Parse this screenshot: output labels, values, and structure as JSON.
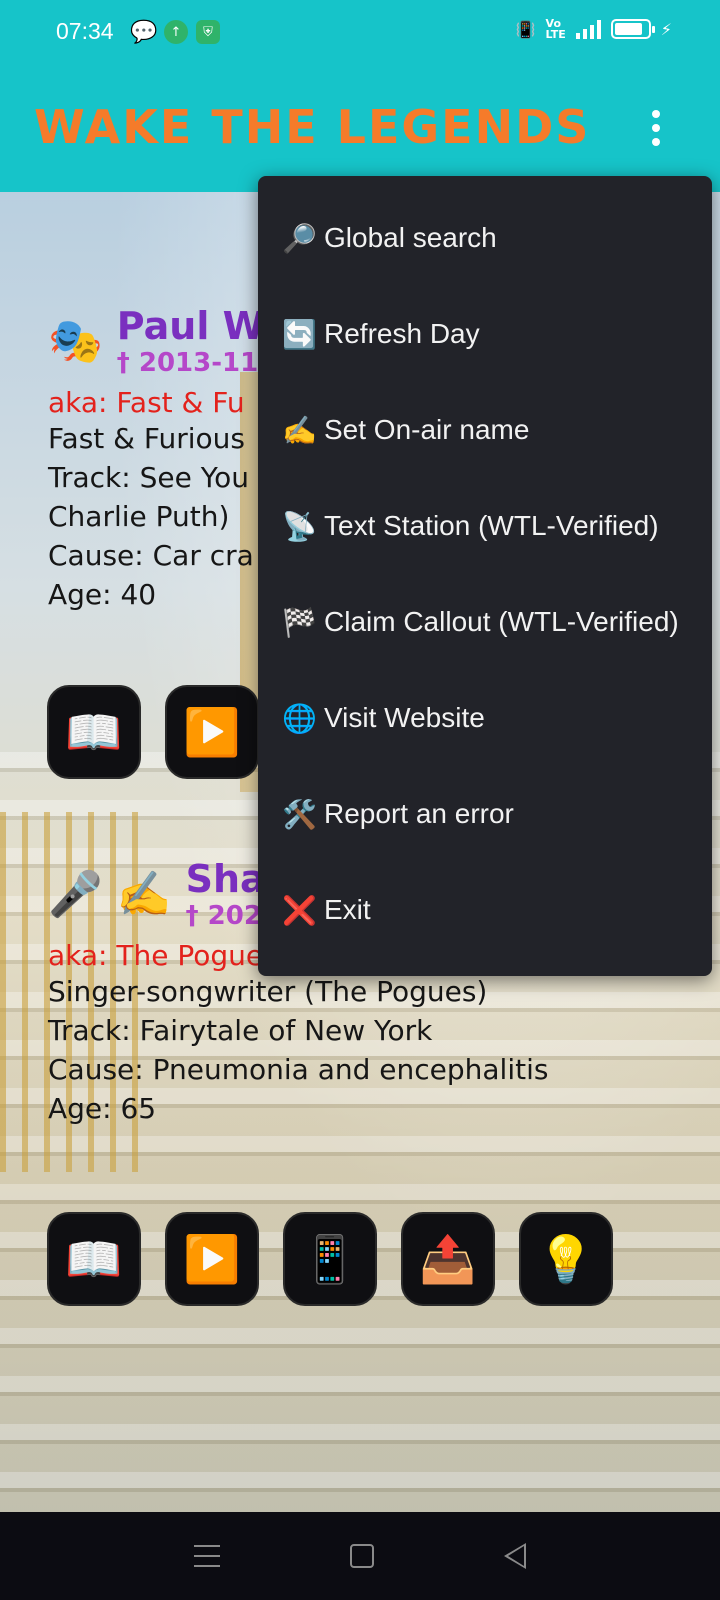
{
  "status_bar": {
    "time": "07:34",
    "left_icons": [
      "chat-bubble-icon",
      "upload-circle-icon",
      "shield-icon"
    ],
    "right_icons": [
      "vibrate-off-icon",
      "volte-icon",
      "signal-icon",
      "battery-icon",
      "charging-icon"
    ],
    "volte_text": "Vo\nLTE",
    "battery_level": 0.85
  },
  "app_bar": {
    "title": "WAKE THE LEGENDS",
    "title_color": "#f57b2a",
    "background": "#16c4c9"
  },
  "entries": [
    {
      "emojis": [
        "🎭"
      ],
      "name": "Paul W",
      "date": "† 2013-11",
      "aka": "aka: Fast & Fu",
      "lines": [
        "Fast & Furious",
        "Track: See You",
        "Charlie Puth)",
        "Cause: Car cra",
        "Age: 40"
      ],
      "buttons": [
        "📖",
        "▶️"
      ]
    },
    {
      "emojis": [
        "🎤",
        "✍️"
      ],
      "name": "Sha",
      "date": "† 202",
      "aka": "aka: The Pogues",
      "lines": [
        "Singer-songwriter (The Pogues)",
        "Track: Fairytale of New York",
        "Cause: Pneumonia and encephalitis",
        "Age: 65"
      ],
      "buttons": [
        "📖",
        "▶️",
        "📱",
        "📤",
        "💡"
      ]
    }
  ],
  "menu": {
    "items": [
      {
        "icon": "🔎",
        "icon_name": "magnifier-icon",
        "label": "Global search"
      },
      {
        "icon": "🔄",
        "icon_name": "refresh-icon",
        "label": "Refresh Day"
      },
      {
        "icon": "✍️",
        "icon_name": "writing-hand-icon",
        "label": "Set On-air name"
      },
      {
        "icon": "📡",
        "icon_name": "satellite-dish-icon",
        "label": "Text Station (WTL-Verified)"
      },
      {
        "icon": "🏁",
        "icon_name": "checkered-flag-icon",
        "label": "Claim Callout (WTL-Verified)"
      },
      {
        "icon": "🌐",
        "icon_name": "globe-icon",
        "label": "Visit Website"
      },
      {
        "icon": "🛠️",
        "icon_name": "tools-icon",
        "label": "Report an error"
      },
      {
        "icon": "❌",
        "icon_name": "cross-mark-icon",
        "label": "Exit"
      }
    ]
  },
  "nav_bar": {
    "buttons": [
      "menu-icon",
      "home-icon",
      "back-icon"
    ]
  }
}
